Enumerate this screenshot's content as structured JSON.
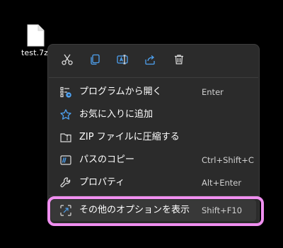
{
  "desktop": {
    "file_name": "test.7z",
    "file_icon": "document-icon"
  },
  "toolbar": {
    "buttons": [
      {
        "icon": "cut-icon"
      },
      {
        "icon": "copy-icon"
      },
      {
        "icon": "rename-icon"
      },
      {
        "icon": "share-icon"
      },
      {
        "icon": "delete-icon"
      }
    ]
  },
  "menu": {
    "items": [
      {
        "label": "プログラムから開く",
        "shortcut": "Enter",
        "icon": "open-with-icon"
      },
      {
        "label": "お気に入りに追加",
        "shortcut": "",
        "icon": "star-icon"
      },
      {
        "label": "ZIP ファイルに圧縮する",
        "shortcut": "",
        "icon": "zip-folder-icon"
      },
      {
        "label": "パスのコピー",
        "shortcut": "Ctrl+Shift+C",
        "icon": "copy-path-icon"
      },
      {
        "label": "プロパティ",
        "shortcut": "Alt+Enter",
        "icon": "wrench-icon"
      }
    ],
    "more": {
      "label": "その他のオプションを表示",
      "shortcut": "Shift+F10",
      "icon": "more-options-icon"
    }
  },
  "colors": {
    "menu_bg": "#2b2b2b",
    "highlight_border": "#f08ff0",
    "text": "#ffffff"
  }
}
